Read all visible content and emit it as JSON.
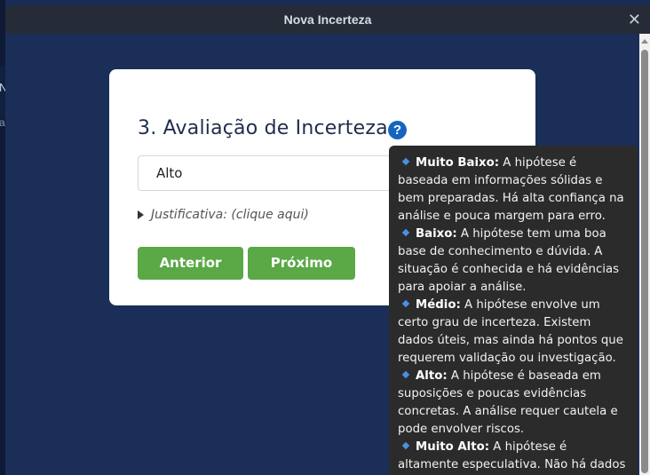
{
  "window": {
    "title": "Nova Incerteza",
    "close_glyph": "✕"
  },
  "background": {
    "char_n": "N",
    "char_a": "a"
  },
  "form": {
    "heading": "3. Avaliação de Incerteza",
    "help_glyph": "?",
    "select_value": "Alto",
    "justification_label": "Justificativa: (clique aqui)",
    "prev_label": "Anterior",
    "next_label": "Próximo"
  },
  "tooltip": {
    "items": [
      {
        "term": "Muito Baixo:",
        "text": " A hipótese é baseada em informações sólidas e bem preparadas. Há alta confiança na análise e pouca margem para erro."
      },
      {
        "term": "Baixo:",
        "text": " A hipótese tem uma boa base de conhecimento e dúvida. A situação é conhecida e há evidências para apoiar a análise."
      },
      {
        "term": "Médio:",
        "text": " A hipótese envolve um certo grau de incerteza. Existem dados úteis, mas ainda há pontos que requerem validação ou investigação."
      },
      {
        "term": "Alto:",
        "text": " A hipótese é baseada em suposições e poucas evidências concretas. A análise requer cautela e pode envolver riscos."
      },
      {
        "term": "Muito Alto:",
        "text": " A hipótese é altamente especulativa. Não há dados disponíveis e"
      }
    ]
  },
  "colors": {
    "accent_green": "#5aa846",
    "help_blue": "#1565c0",
    "background_navy": "#1b2e58",
    "tooltip_bg": "#2b2b2b"
  }
}
